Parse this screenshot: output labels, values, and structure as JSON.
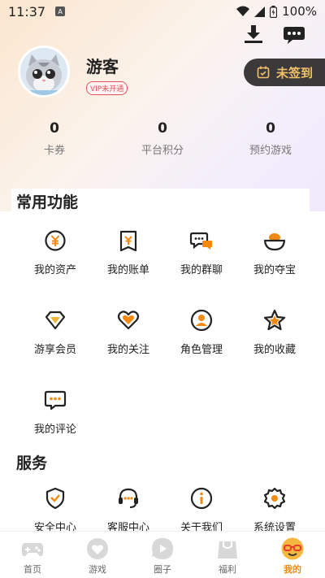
{
  "status_bar": {
    "time": "11:37",
    "battery": "100%"
  },
  "header": {
    "download_icon": "download-icon",
    "message_icon": "chat-icon"
  },
  "profile": {
    "username": "游客",
    "vip_status": "VIP未开通",
    "signin_label": "未签到"
  },
  "stats": [
    {
      "value": "0",
      "label": "卡券"
    },
    {
      "value": "0",
      "label": "平台积分"
    },
    {
      "value": "0",
      "label": "预约游戏"
    }
  ],
  "common_functions": {
    "title": "常用功能",
    "items": [
      {
        "label": "我的资产",
        "icon": "yen-coin-icon"
      },
      {
        "label": "我的账单",
        "icon": "bill-icon"
      },
      {
        "label": "我的群聊",
        "icon": "group-chat-icon"
      },
      {
        "label": "我的夺宝",
        "icon": "treasure-icon"
      },
      {
        "label": "游享会员",
        "icon": "diamond-icon"
      },
      {
        "label": "我的关注",
        "icon": "heart-icon"
      },
      {
        "label": "角色管理",
        "icon": "user-icon"
      },
      {
        "label": "我的收藏",
        "icon": "star-icon"
      },
      {
        "label": "我的评论",
        "icon": "comment-icon"
      }
    ]
  },
  "services": {
    "title": "服务",
    "items": [
      {
        "label": "安全中心",
        "icon": "shield-icon"
      },
      {
        "label": "客服中心",
        "icon": "headset-icon"
      },
      {
        "label": "关于我们",
        "icon": "info-icon"
      },
      {
        "label": "系统设置",
        "icon": "gear-icon"
      }
    ]
  },
  "tabbar": [
    {
      "label": "首页",
      "active": false
    },
    {
      "label": "游戏",
      "active": false
    },
    {
      "label": "圈子",
      "active": false
    },
    {
      "label": "福利",
      "active": false
    },
    {
      "label": "我的",
      "active": true
    }
  ],
  "colors": {
    "accent": "#f08a12",
    "icon_stroke": "#222222",
    "signin_bg": "#3b3939",
    "signin_text": "#f4c16b"
  }
}
